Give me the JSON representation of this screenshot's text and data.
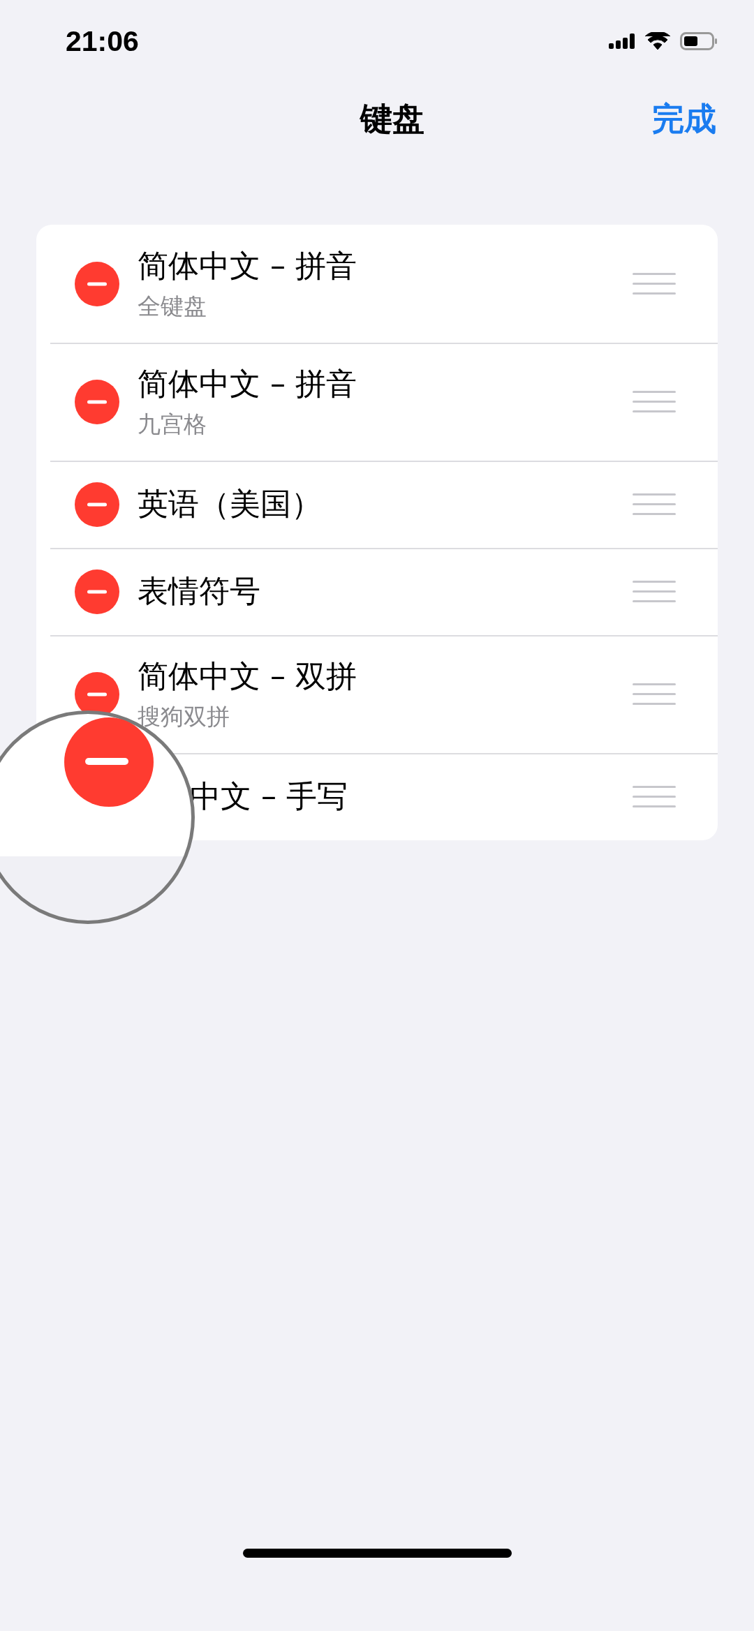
{
  "status_bar": {
    "time": "21:06"
  },
  "nav": {
    "title": "键盘",
    "done": "完成"
  },
  "keyboards": [
    {
      "title": "简体中文 – 拼音",
      "subtitle": "全键盘",
      "covered": false
    },
    {
      "title": "简体中文 – 拼音",
      "subtitle": "九宫格",
      "covered": false
    },
    {
      "title": "英语（美国）",
      "covered": false
    },
    {
      "title": "表情符号",
      "covered": false
    },
    {
      "title": "简体中文 – 双拼",
      "subtitle": "搜狗双拼",
      "covered": false
    },
    {
      "title": "中文 – 手写",
      "covered": true
    }
  ]
}
